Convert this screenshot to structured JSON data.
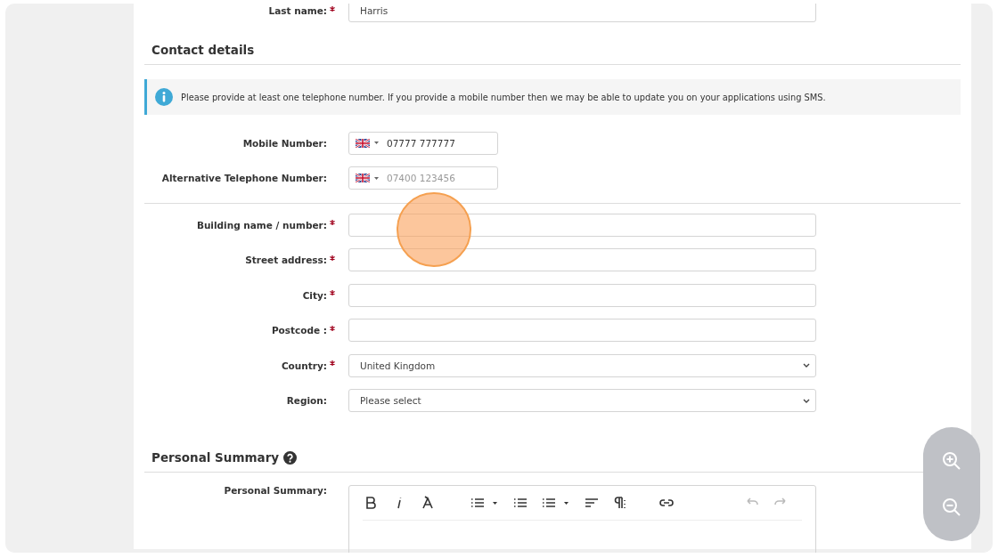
{
  "top_field": {
    "label": "Last name:",
    "required": true,
    "value": "Harris"
  },
  "contact": {
    "title": "Contact details",
    "info": "Please provide at least one telephone number. If you provide a mobile number then we may be able to update you on your applications using SMS.",
    "phones": [
      {
        "label": "Mobile Number:",
        "value": "07777 777777"
      },
      {
        "label": "Alternative Telephone Number:",
        "placeholder": "07400 123456"
      }
    ]
  },
  "address": [
    {
      "label": "Building name / number:",
      "required": true,
      "kind": "text"
    },
    {
      "label": "Street address:",
      "required": true,
      "kind": "text"
    },
    {
      "label": "City:",
      "required": true,
      "kind": "text"
    },
    {
      "label": "Postcode :",
      "required": true,
      "kind": "text"
    },
    {
      "label": "Country:",
      "required": true,
      "kind": "select",
      "value": "United Kingdom"
    },
    {
      "label": "Region:",
      "required": false,
      "kind": "select",
      "value": "Please select"
    }
  ],
  "summary": {
    "title": "Personal Summary",
    "label": "Personal Summary:",
    "toolbar": [
      {
        "kind": "bold",
        "disabled": false
      },
      {
        "kind": "italic",
        "disabled": false
      },
      {
        "kind": "clear-format",
        "disabled": false
      },
      {
        "kind": "bullets",
        "disabled": false
      },
      {
        "kind": "numbers",
        "disabled": false
      },
      {
        "kind": "numbers-menu",
        "disabled": false
      },
      {
        "kind": "align",
        "disabled": false
      },
      {
        "kind": "paragraph",
        "disabled": false
      },
      {
        "kind": "link",
        "disabled": false
      },
      {
        "kind": "undo",
        "disabled": true
      },
      {
        "kind": "redo",
        "disabled": true
      }
    ]
  }
}
